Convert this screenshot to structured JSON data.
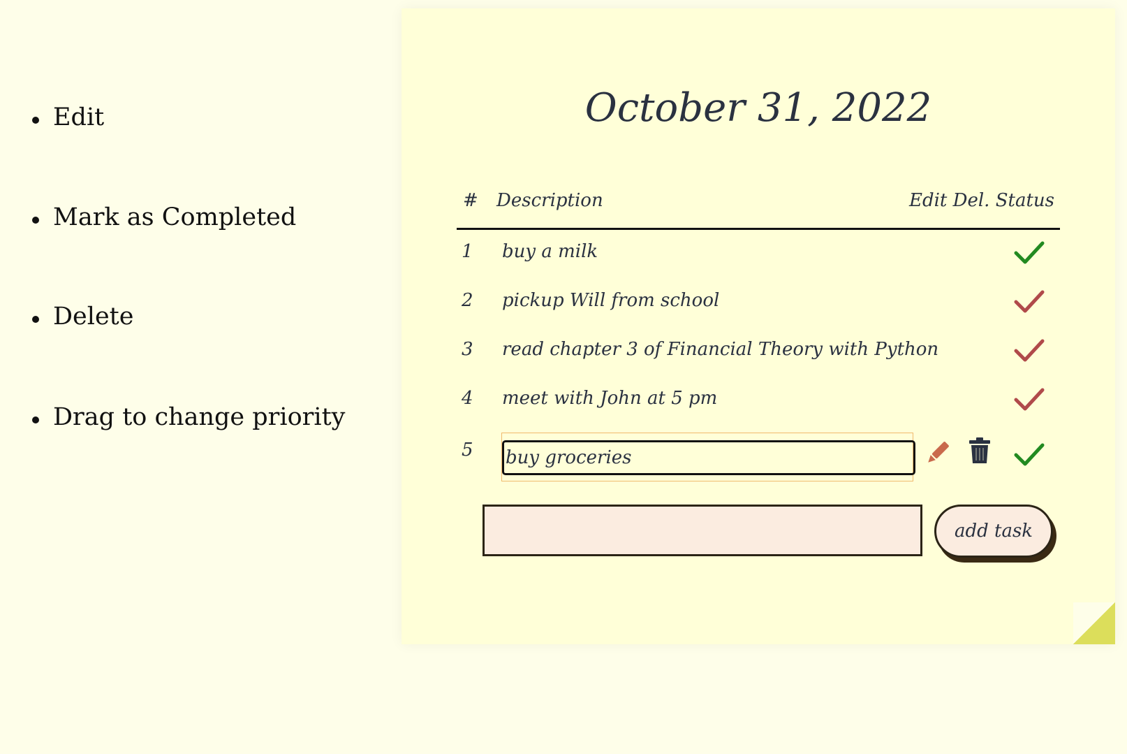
{
  "features": [
    {
      "label": "Edit"
    },
    {
      "label": "Mark as Completed"
    },
    {
      "label": "Delete"
    },
    {
      "label": "Drag to change priority"
    }
  ],
  "note": {
    "date": "October 31, 2022",
    "headers": {
      "num": "#",
      "description": "Description",
      "actions": "Edit Del. Status"
    },
    "tasks": [
      {
        "num": "1",
        "description": "buy a milk",
        "completed": true
      },
      {
        "num": "2",
        "description": "pickup Will from school",
        "completed": false
      },
      {
        "num": "3",
        "description": "read chapter 3 of Financial Theory with Python",
        "completed": false
      },
      {
        "num": "4",
        "description": "meet with John at 5 pm",
        "completed": false
      },
      {
        "num": "5",
        "description": "buy groceries",
        "completed": true,
        "editing": true
      }
    ],
    "new_task": {
      "value": "",
      "placeholder": ""
    },
    "add_button_label": "add task",
    "icons": {
      "edit": "pencil-icon",
      "delete": "trash-icon",
      "status": "check-icon"
    },
    "colors": {
      "note_bg": "#ffffd8",
      "completed": "#228a20",
      "incomplete": "#b04a4a",
      "pencil": "#c96a4c",
      "trash": "#2a3140",
      "corner": "#dcde5b"
    }
  }
}
